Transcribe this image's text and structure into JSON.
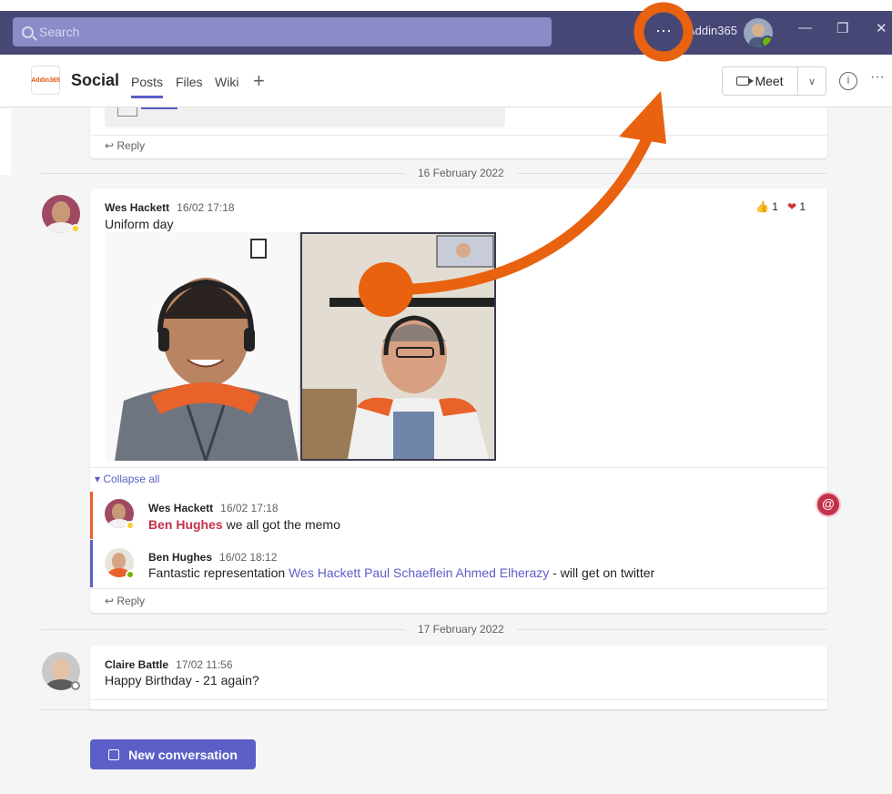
{
  "titlebar": {
    "search_placeholder": "Search",
    "more_label": "···",
    "tenant": "Addin365",
    "minimize": "—",
    "maximize": "❐",
    "close": "✕"
  },
  "channel": {
    "logo_text": "Addin365",
    "name": "Social",
    "tabs": [
      "Posts",
      "Files",
      "Wiki"
    ],
    "add_tab": "+",
    "meet_label": "Meet",
    "meet_dropdown": "∨",
    "info": "i",
    "more": "···"
  },
  "feed": {
    "reply_label": "Reply",
    "dates": [
      "16 February 2022",
      "17 February 2022"
    ],
    "post1": {
      "author": "Wes Hackett",
      "time": "16/02 17:18",
      "text": "Uniform day",
      "reactions": [
        {
          "icon": "👍",
          "count": "1"
        },
        {
          "icon": "❤",
          "count": "1"
        }
      ],
      "collapse_label": "Collapse all",
      "replies": [
        {
          "author": "Wes Hackett",
          "time": "16/02 17:18",
          "mention": "Ben Hughes",
          "text": " we all got the memo"
        },
        {
          "author": "Ben Hughes",
          "time": "16/02 18:12",
          "prefix": "Fantastic representation ",
          "mentions": [
            "Wes Hackett",
            "Paul Schaeflein",
            "Ahmed Elherazy"
          ],
          "suffix": " - will get on twitter"
        }
      ],
      "mention_badge": "@"
    },
    "post2": {
      "author": "Claire Battle",
      "time": "17/02 11:56",
      "text": "Happy Birthday - 21 again?"
    },
    "new_conversation": "New conversation"
  },
  "colors": {
    "titlebar": "#464775",
    "accent": "#5b5fc7",
    "annotation": "#e8620f",
    "mention_me": "#c4314b"
  }
}
